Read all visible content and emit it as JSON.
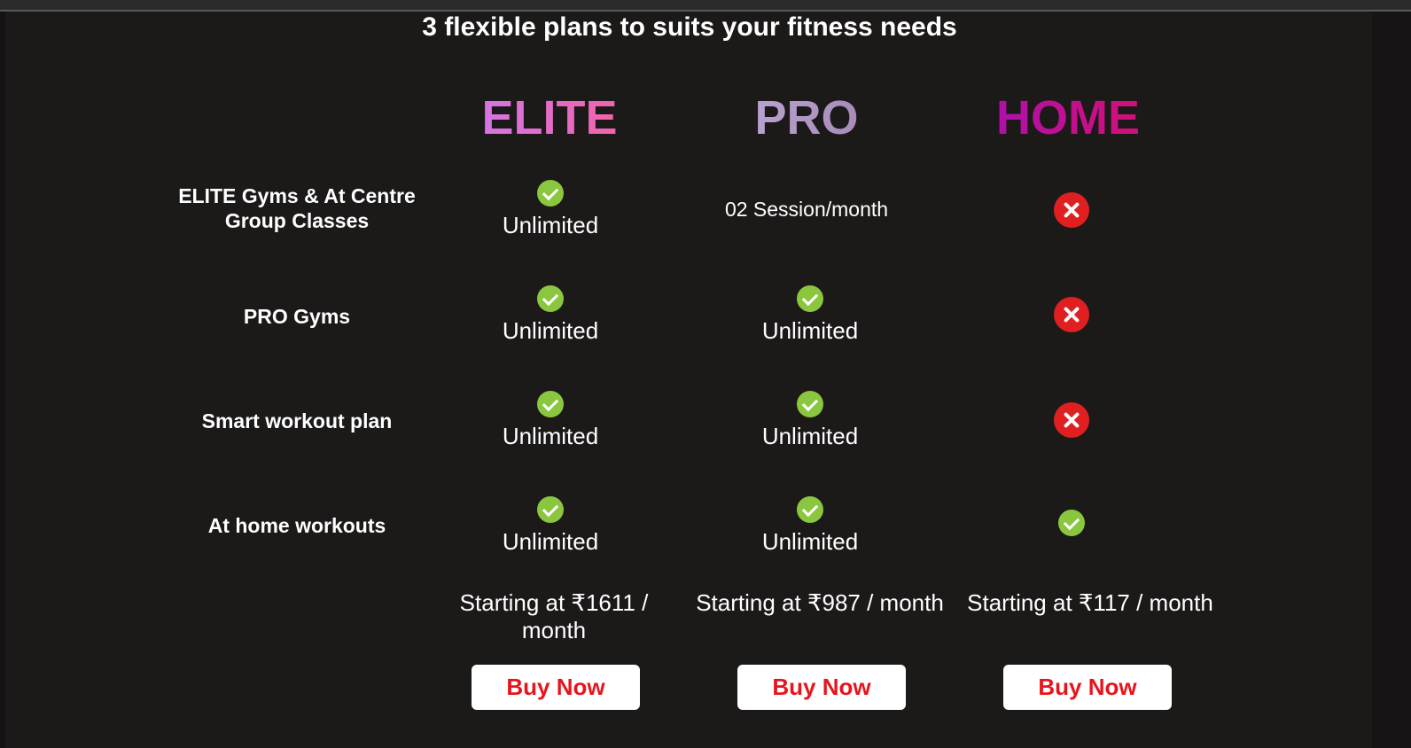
{
  "title": "3 flexible plans to suits your fitness needs",
  "plans": [
    {
      "name": "ELITE",
      "gradient": [
        "#c77dff",
        "#ff5b8f"
      ],
      "price": "Starting at ₹1611 / month",
      "button": "Buy Now"
    },
    {
      "name": "PRO",
      "gradient": [
        "#c6b4e0",
        "#9a7aa8"
      ],
      "price": "Starting at ₹987 / month",
      "button": "Buy Now"
    },
    {
      "name": "HOME",
      "gradient": [
        "#a010c0",
        "#e01060"
      ],
      "price": "Starting at ₹117 / month",
      "button": "Buy Now"
    }
  ],
  "features": [
    {
      "label": "ELITE Gyms & At Centre Group Classes",
      "cells": [
        {
          "icon": "check-icon",
          "text": "Unlimited"
        },
        {
          "icon": "",
          "text": "02 Session/month"
        },
        {
          "icon": "cross-icon",
          "text": ""
        }
      ]
    },
    {
      "label": "PRO Gyms",
      "cells": [
        {
          "icon": "check-icon",
          "text": "Unlimited"
        },
        {
          "icon": "check-icon",
          "text": "Unlimited"
        },
        {
          "icon": "cross-icon",
          "text": ""
        }
      ]
    },
    {
      "label": "Smart workout plan",
      "cells": [
        {
          "icon": "check-icon",
          "text": "Unlimited"
        },
        {
          "icon": "check-icon",
          "text": "Unlimited"
        },
        {
          "icon": "cross-icon",
          "text": ""
        }
      ]
    },
    {
      "label": "At home workouts",
      "cells": [
        {
          "icon": "check-icon",
          "text": "Unlimited"
        },
        {
          "icon": "check-icon",
          "text": "Unlimited"
        },
        {
          "icon": "check-icon",
          "text": ""
        }
      ]
    }
  ],
  "colors": {
    "background": "#1c1919",
    "check": "#8bc63f",
    "cross": "#e02020",
    "button_text": "#e8141c"
  }
}
